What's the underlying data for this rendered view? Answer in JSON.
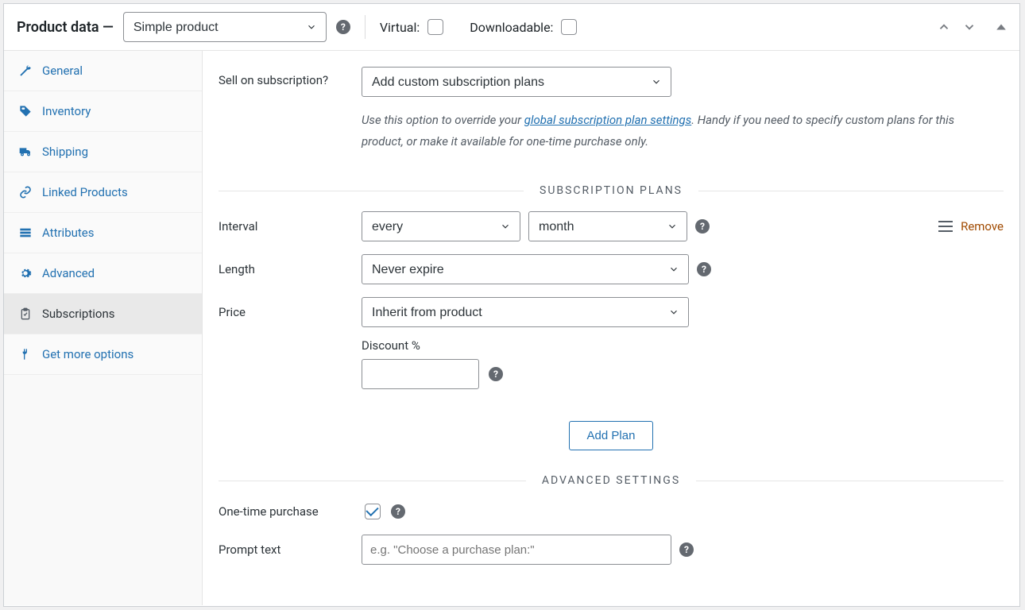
{
  "header": {
    "title": "Product data —",
    "product_type": "Simple product",
    "virtual_label": "Virtual:",
    "downloadable_label": "Downloadable:"
  },
  "tabs": [
    {
      "label": "General"
    },
    {
      "label": "Inventory"
    },
    {
      "label": "Shipping"
    },
    {
      "label": "Linked Products"
    },
    {
      "label": "Attributes"
    },
    {
      "label": "Advanced"
    },
    {
      "label": "Subscriptions"
    },
    {
      "label": "Get more options"
    }
  ],
  "sell_on_subscription": {
    "label": "Sell on subscription?",
    "selected": "Add custom subscription plans",
    "desc_prefix": "Use this option to override your ",
    "desc_link": "global subscription plan settings",
    "desc_suffix": ". Handy if you need to specify custom plans for this product, or make it available for one-time purchase only."
  },
  "section_plans_title": "SUBSCRIPTION PLANS",
  "plan": {
    "interval_label": "Interval",
    "interval_every": "every",
    "interval_unit": "month",
    "length_label": "Length",
    "length_value": "Never expire",
    "price_label": "Price",
    "price_value": "Inherit from product",
    "discount_label": "Discount %",
    "remove_label": "Remove"
  },
  "add_plan_label": "Add Plan",
  "section_advanced_title": "ADVANCED SETTINGS",
  "advanced": {
    "otp_label": "One-time purchase",
    "otp_checked": true,
    "prompt_label": "Prompt text",
    "prompt_placeholder": "e.g. \"Choose a purchase plan:\""
  }
}
